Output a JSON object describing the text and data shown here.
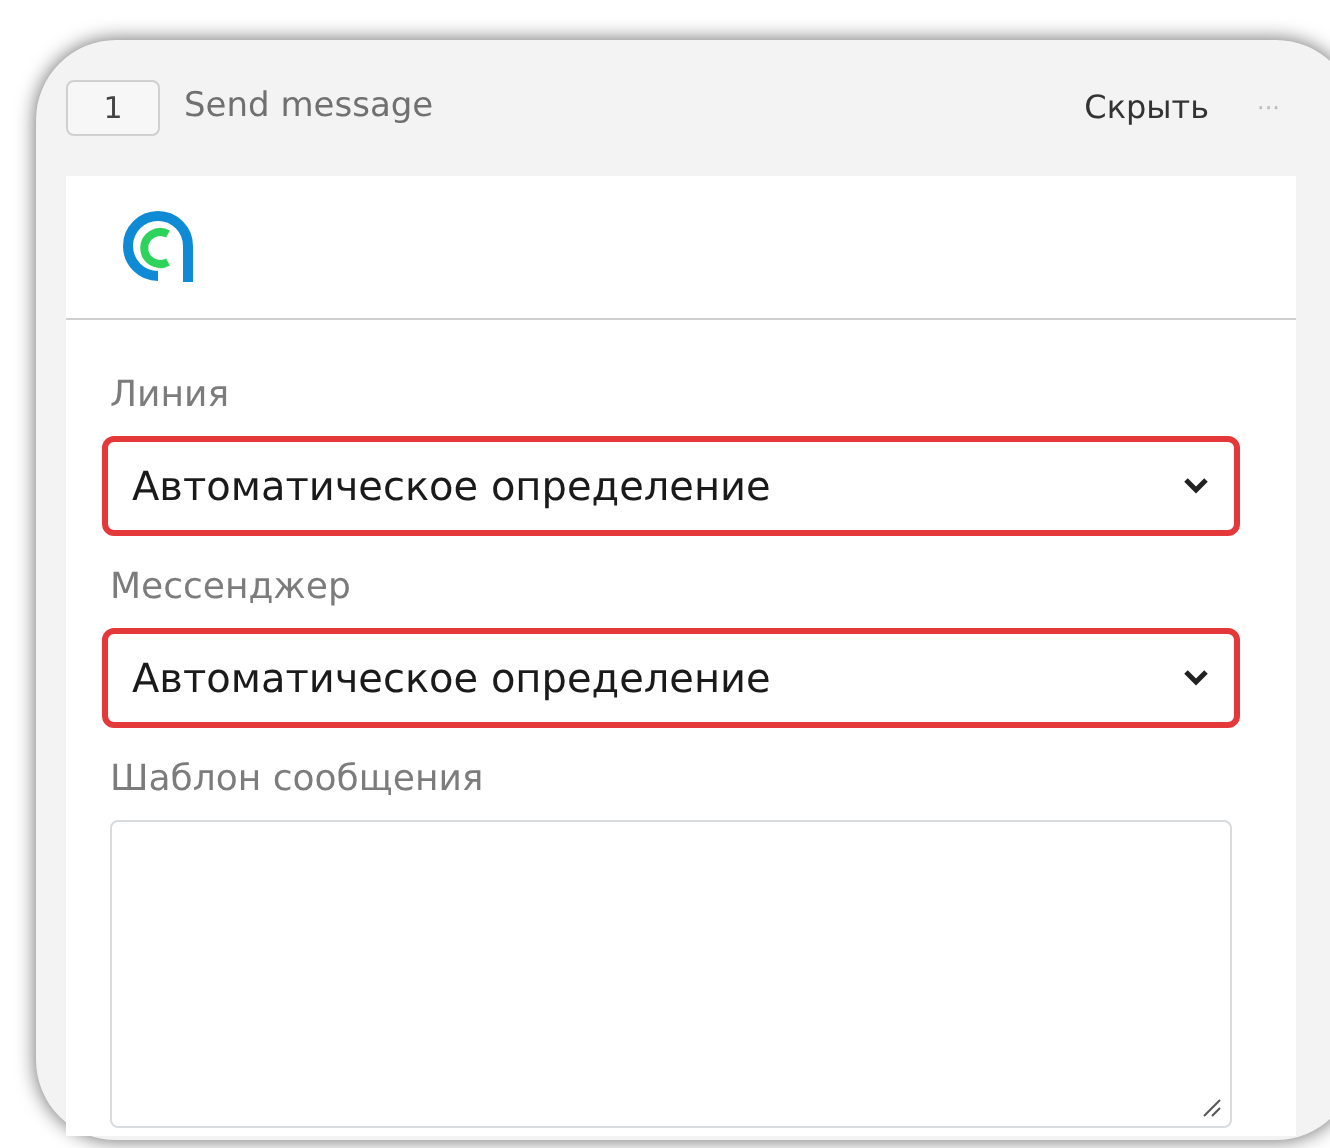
{
  "header": {
    "step": "1",
    "title": "Send message",
    "hide": "Скрыть",
    "more": "···"
  },
  "fields": [
    {
      "kind": "select",
      "label": "Линия",
      "value": "Автоматическое определение",
      "highlighted": true
    },
    {
      "kind": "select",
      "label": "Мессенджер",
      "value": "Автоматическое определение",
      "highlighted": true
    },
    {
      "kind": "textarea",
      "label": "Шаблон сообщения",
      "highlighted": false
    }
  ]
}
